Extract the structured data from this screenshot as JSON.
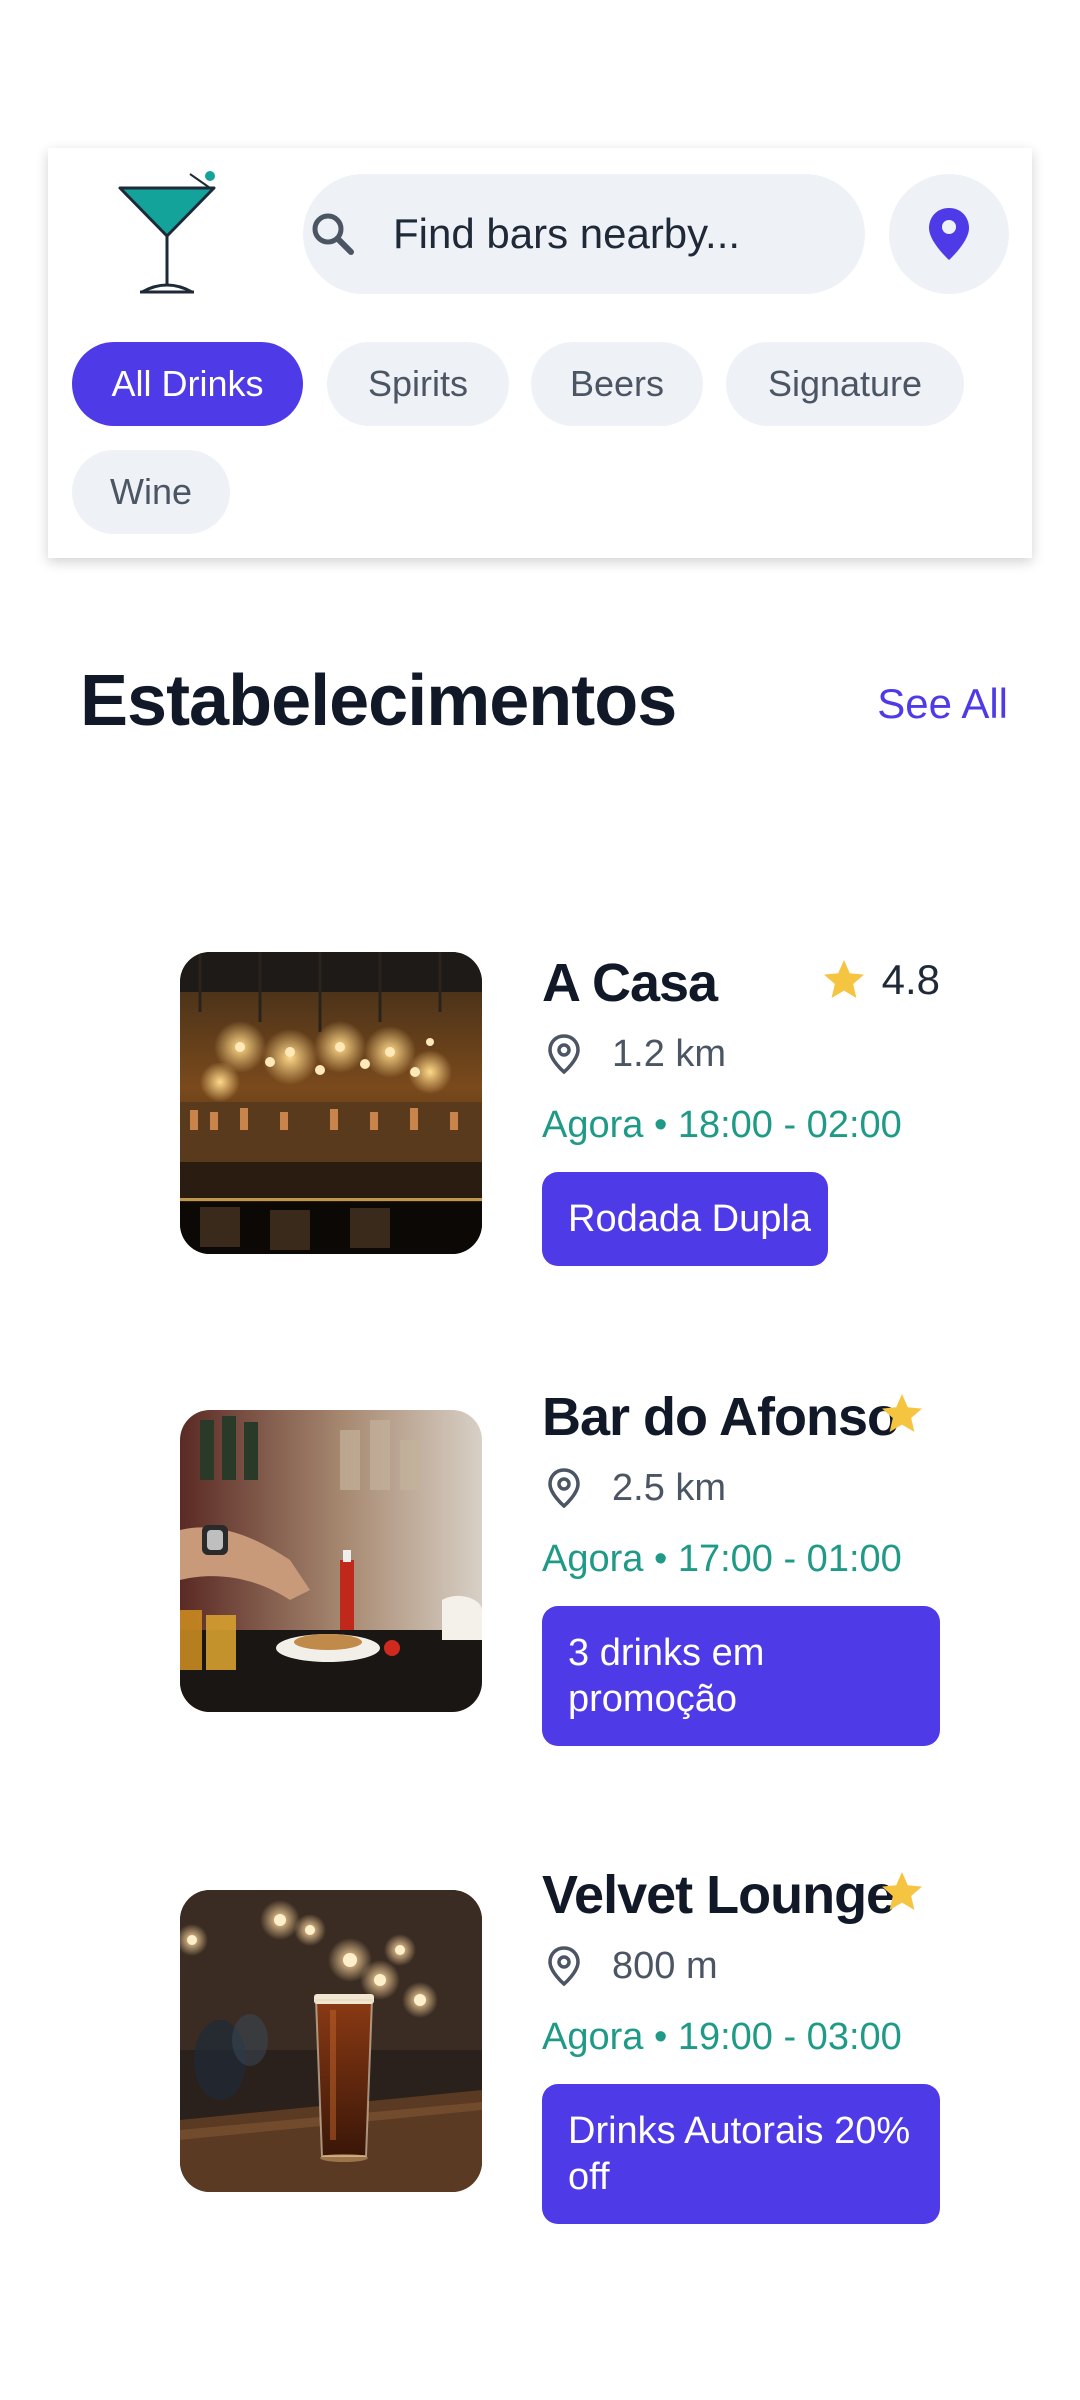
{
  "header": {
    "search": {
      "placeholder": "Find bars nearby..."
    },
    "chips": [
      {
        "label": "All Drinks",
        "active": true
      },
      {
        "label": "Spirits",
        "active": false
      },
      {
        "label": "Beers",
        "active": false
      },
      {
        "label": "Signature",
        "active": false
      },
      {
        "label": "Wine",
        "active": false
      }
    ],
    "icons": [
      "cocktail-logo-icon",
      "search-icon",
      "location-pin-icon"
    ]
  },
  "section": {
    "title": "Estabelecimentos",
    "see_all": "See All"
  },
  "venues": [
    {
      "name": "A Casa",
      "rating": "4.8",
      "distance": "1.2 km",
      "hours": "Agora • 18:00 - 02:00",
      "promo": "Rodada Dupla"
    },
    {
      "name": "Bar do Afonso",
      "distance": "2.5 km",
      "hours": "Agora • 17:00 - 01:00",
      "promo": "3 drinks em promoção"
    },
    {
      "name": "Velvet Lounge",
      "distance": "800 m",
      "hours": "Agora • 19:00 - 03:00",
      "promo": "Drinks Autorais 20% off"
    }
  ],
  "colors": {
    "accent": "#4f3ae8",
    "teal": "#1f9a86",
    "star": "#f5c542",
    "chip_bg": "#eef2f7"
  }
}
